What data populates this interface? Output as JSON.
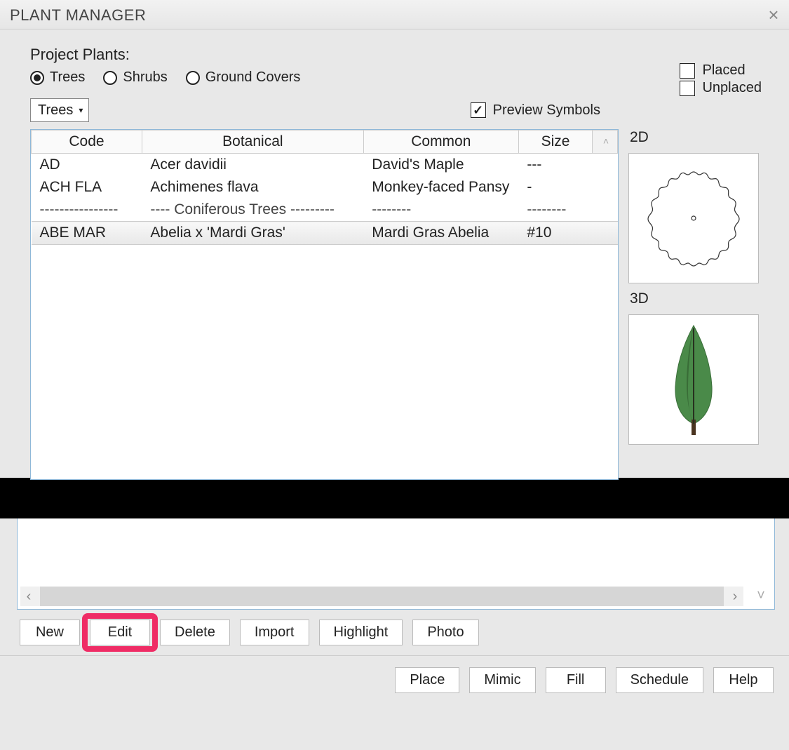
{
  "title": "PLANT MANAGER",
  "group_label": "Project Plants:",
  "radios": {
    "trees": "Trees",
    "shrubs": "Shrubs",
    "ground": "Ground Covers",
    "selected": "trees"
  },
  "filter_checks": {
    "placed": "Placed",
    "unplaced": "Unplaced"
  },
  "dropdown_value": "Trees",
  "preview_symbols_label": "Preview Symbols",
  "preview_symbols_checked": true,
  "columns": {
    "code": "Code",
    "botanical": "Botanical",
    "common": "Common",
    "size": "Size"
  },
  "rows": [
    {
      "code": "AD",
      "botanical": "Acer davidii",
      "common": "David's Maple",
      "size": "---"
    },
    {
      "code": "ACH FLA",
      "botanical": "Achimenes flava",
      "common": "Monkey-faced Pansy",
      "size": "-"
    },
    {
      "sep": true,
      "code": "----------------",
      "botanical": "---- Coniferous Trees ---------",
      "common": "--------",
      "size": "--------"
    },
    {
      "code": "ABE MAR",
      "botanical": "Abelia x 'Mardi Gras'",
      "common": "Mardi Gras Abelia",
      "size": "#10",
      "selected": true
    }
  ],
  "preview_labels": {
    "p2d": "2D",
    "p3d": "3D"
  },
  "buttons_row1": {
    "new": "New",
    "edit": "Edit",
    "delete": "Delete",
    "import": "Import",
    "highlight": "Highlight",
    "photo": "Photo"
  },
  "buttons_row2": {
    "place": "Place",
    "mimic": "Mimic",
    "fill": "Fill",
    "schedule": "Schedule",
    "help": "Help"
  }
}
